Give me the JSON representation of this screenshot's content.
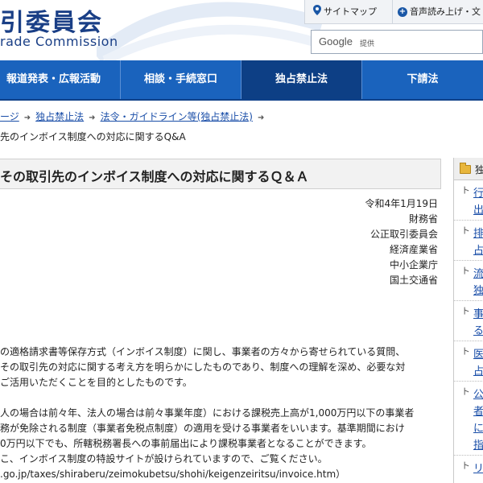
{
  "header": {
    "logo_title": "引委員会",
    "logo_subtitle": "rade Commission",
    "sitemap_label": "サイトマップ",
    "voice_label": "音声読み上げ・文",
    "search_provider": "Google",
    "search_provided": "提供"
  },
  "nav": {
    "items": [
      "報道発表・広報活動",
      "相談・手続窓口",
      "独占禁止法",
      "下請法"
    ],
    "active_index": 2
  },
  "breadcrumb": {
    "items": [
      "ージ",
      "独占禁止法",
      "法令・ガイドライン等(独占禁止法)"
    ],
    "current": "先のインボイス制度への対応に関するQ&A"
  },
  "page": {
    "title": "その取引先のインボイス制度への対応に関するＱ＆Ａ",
    "date": "令和4年1月19日",
    "issuers": [
      "財務省",
      "公正取引委員会",
      "経済産業省",
      "中小企業庁",
      "国土交通省"
    ],
    "paragraphs": [
      "の適格請求書等保存方式（インボイス制度）に関し、事業者の方々から寄せられている質問、",
      "その取引先の対応に関する考え方を明らかにしたものであり、制度への理解を深め、必要な対",
      "ご活用いただくことを目的としたものです。",
      "",
      "人の場合は前々年、法人の場合は前々事業年度）における課税売上高が1,000万円以下の事業者",
      "務が免除される制度（事業者免税点制度）の適用を受ける事業者をいいます。基準期間におけ",
      "0万円以下でも、所轄税務署長への事前届出により課税事業者となることができます。",
      "こ、インボイス制度の特設サイトが設けられていますので、ご覧ください。",
      ".go.jp/taxes/shiraberu/zeimokubetsu/shohi/keigenzeiritsu/invoice.htm）"
    ]
  },
  "sidebar": {
    "heading": "独",
    "items": [
      "行\n出",
      "排\n占",
      "流\n独",
      "事\nる",
      "医\n占",
      "公\n者\nに\n指",
      "リ\n"
    ]
  },
  "colors": {
    "nav_bg": "#1a63bd",
    "nav_active_bg": "#0d3f85",
    "link": "#1a4ea8",
    "logo": "#1a3f86"
  }
}
